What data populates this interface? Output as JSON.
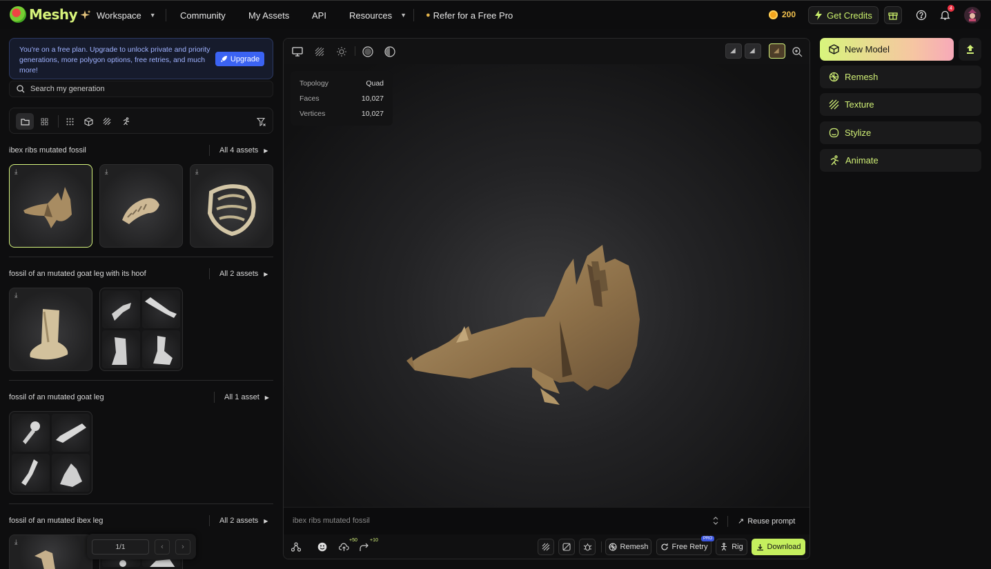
{
  "header": {
    "brand": "Meshy",
    "nav": [
      {
        "label": "Workspace"
      },
      {
        "label": "Community"
      },
      {
        "label": "My Assets"
      },
      {
        "label": "API"
      },
      {
        "label": "Resources"
      },
      {
        "label": "Refer for a Free Pro"
      }
    ],
    "credits": "200",
    "get_credits": "Get Credits",
    "notification_count": "4"
  },
  "sidebar": {
    "banner_text": "You're on a free plan. Upgrade to unlock private and priority generations, more polygon options, free retries, and much more!",
    "upgrade_label": "Upgrade",
    "search_placeholder": "Search my generation",
    "groups": [
      {
        "title": "ibex ribs mutated fossil",
        "all": "All 4 assets"
      },
      {
        "title": "fossil of an mutated goat leg with its hoof",
        "all": "All 2 assets"
      },
      {
        "title": "fossil of an mutated goat leg",
        "all": "All 1 asset"
      },
      {
        "title": "fossil of an mutated ibex leg",
        "all": "All 2 assets"
      }
    ],
    "pager": "1/1"
  },
  "viewer": {
    "stats": {
      "topology_label": "Topology",
      "topology_value": "Quad",
      "faces_label": "Faces",
      "faces_value": "10,027",
      "vertices_label": "Vertices",
      "vertices_value": "10,027"
    },
    "prompt": "ibex ribs mutated fossil",
    "reuse_prompt": "Reuse prompt",
    "bottom": {
      "badge_50": "+50",
      "badge_10": "+10",
      "remesh": "Remesh",
      "free_retry": "Free Retry",
      "pro": "PRO",
      "rig": "Rig",
      "download": "Download"
    }
  },
  "right_panel": {
    "new_model": "New Model",
    "remesh": "Remesh",
    "texture": "Texture",
    "stylize": "Stylize",
    "animate": "Animate"
  },
  "colors": {
    "accent": "#d7f57e",
    "upgrade": "#3b63f3",
    "download": "#c5ef5e"
  }
}
